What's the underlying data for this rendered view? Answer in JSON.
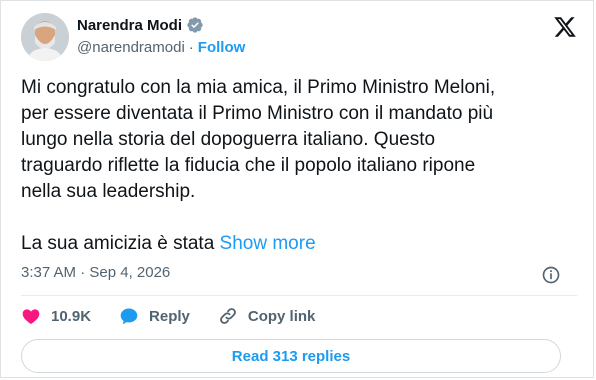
{
  "author": {
    "name": "Narendra Modi",
    "handle": "@narendramodi",
    "follow_label": "Follow"
  },
  "tweet": {
    "text": "Mi congratulo con la mia amica, il Primo Ministro Meloni,\nper essere diventata il Primo Ministro con il mandato più\nlungo nella storia del dopoguerra italiano. Questo\ntraguardo riflette la fiducia che il popolo italiano ripone\nnella sua leadership.",
    "continuation": "La sua amicizia è stata ",
    "show_more": "Show more",
    "timestamp": "3:37 AM · Sep 4, 2026"
  },
  "actions": {
    "likes": "10.9K",
    "reply_label": "Reply",
    "copy_link_label": "Copy link"
  },
  "replies_button": "Read 313 replies",
  "colors": {
    "accent": "#1d9bf0",
    "heart": "#f91880",
    "text": "#0f1419",
    "muted": "#536471"
  },
  "icons": [
    "verified-badge-icon",
    "x-logo-icon",
    "info-icon",
    "heart-icon",
    "reply-bubble-icon",
    "link-icon"
  ]
}
